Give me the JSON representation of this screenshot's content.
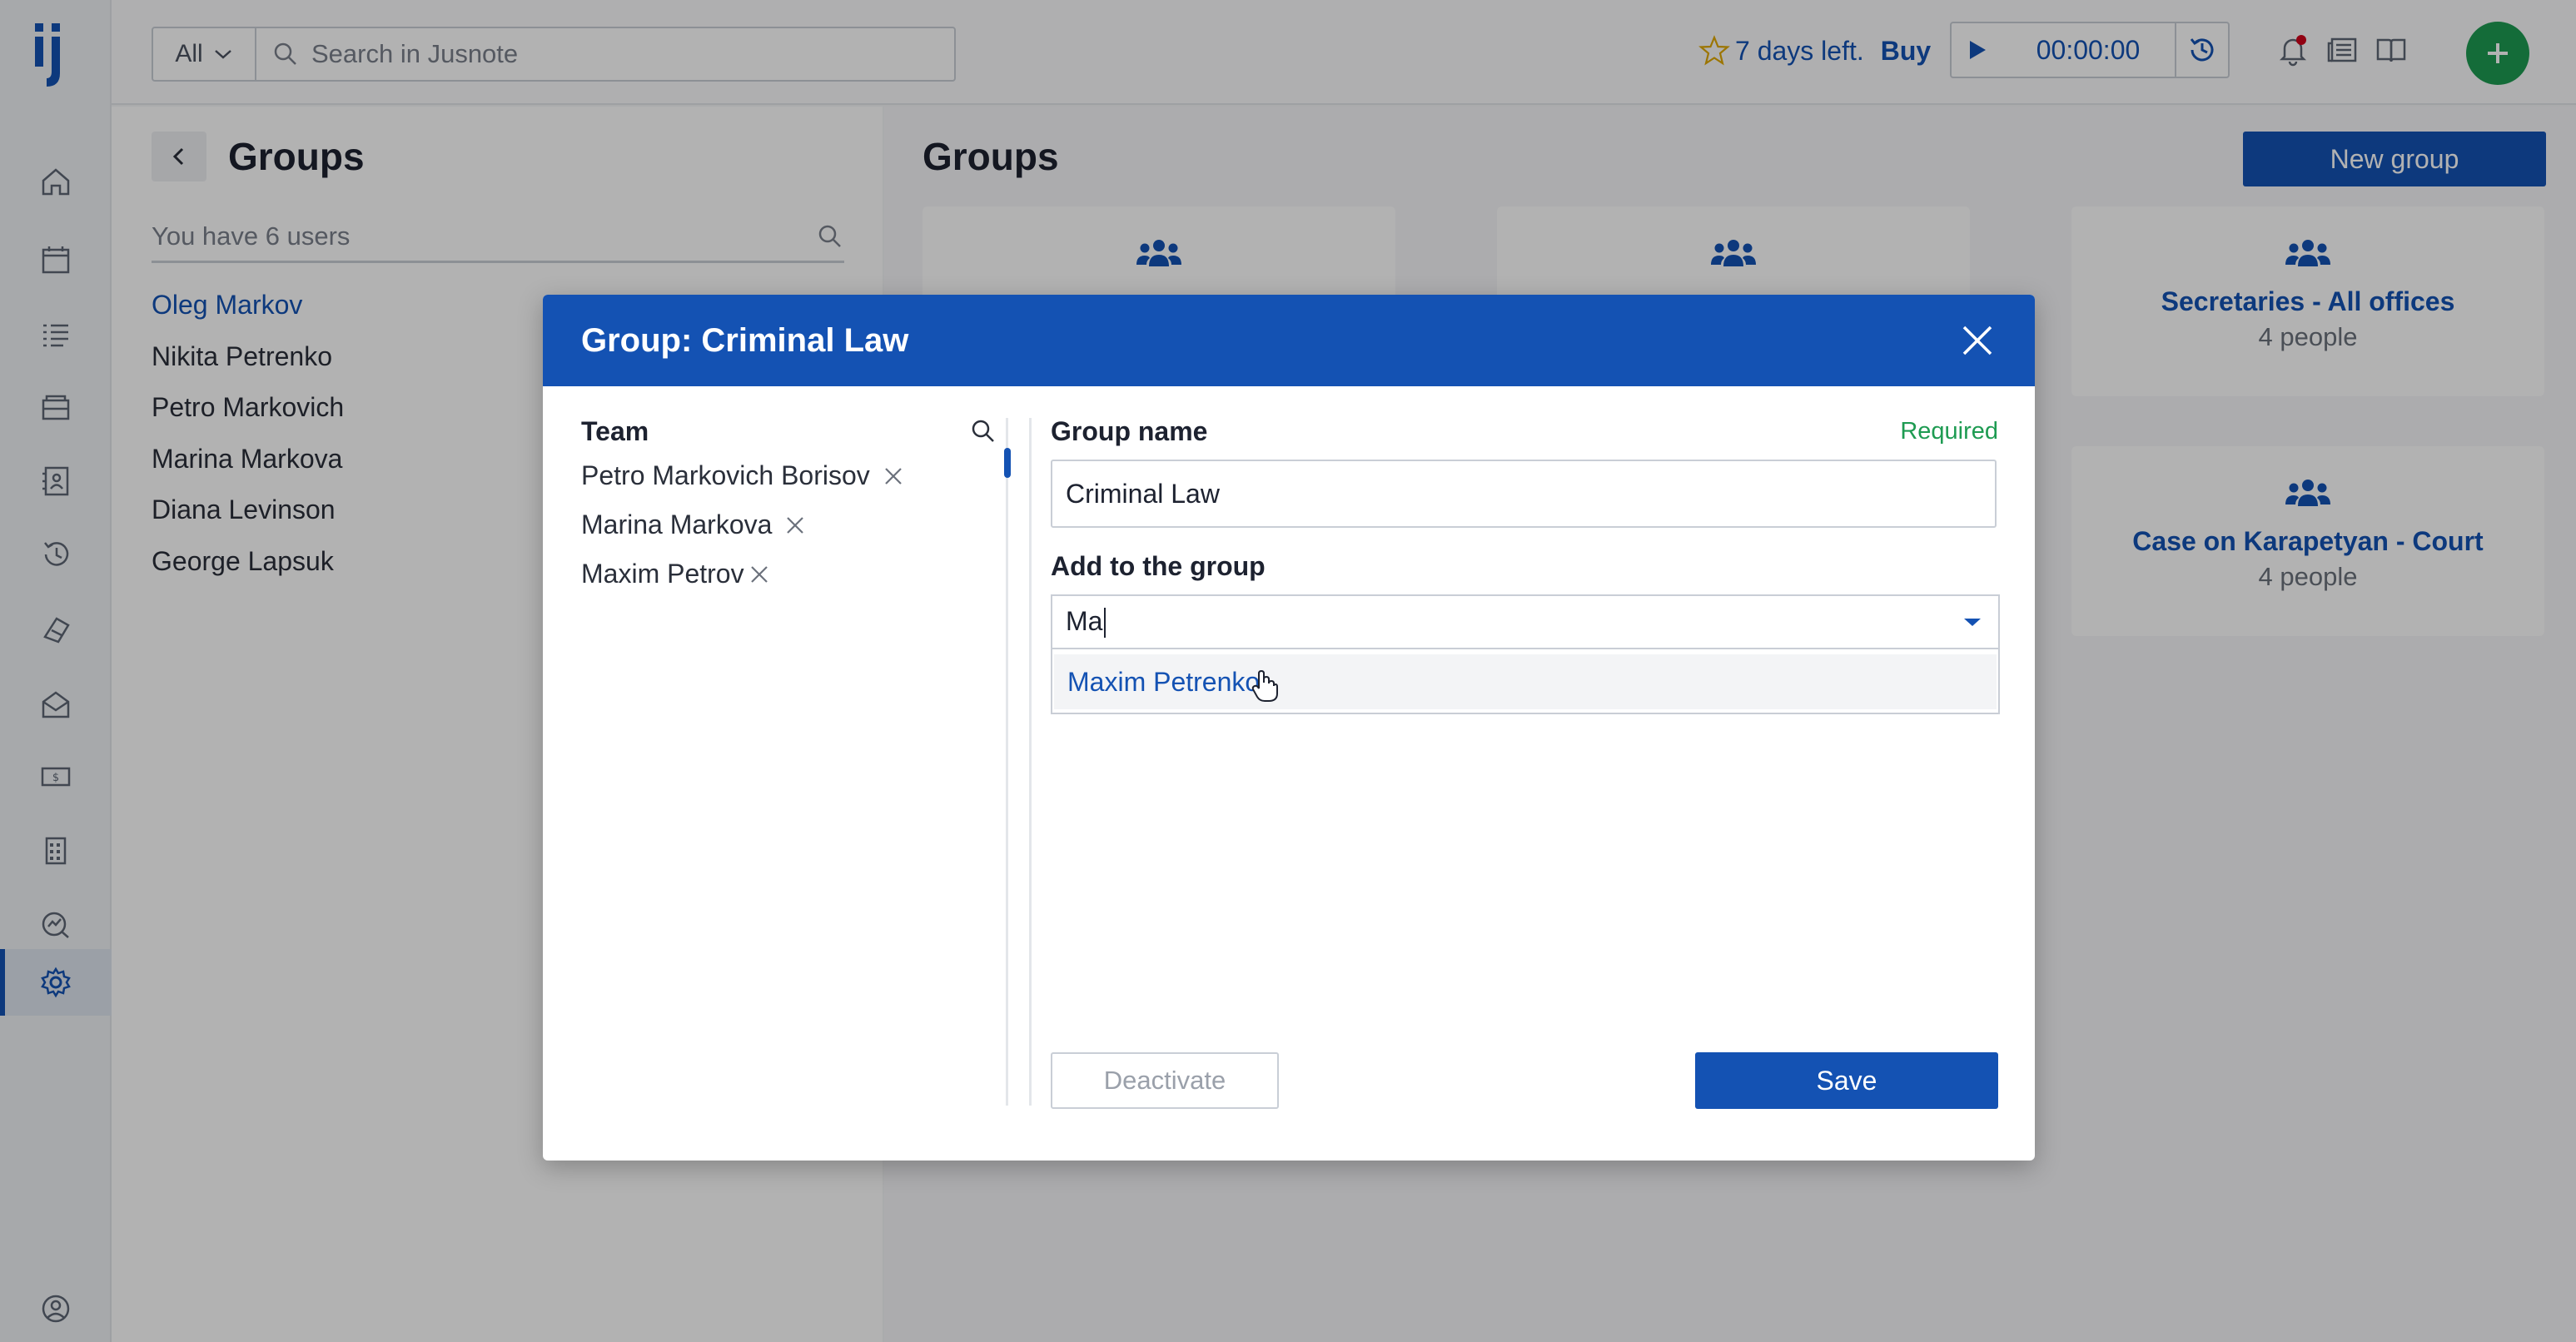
{
  "topbar": {
    "search_scope": "All",
    "search_placeholder": "Search in Jusnote",
    "trial_text": "7 days left.",
    "trial_buy": "Buy",
    "timer": "00:00:00"
  },
  "left_pane": {
    "title": "Groups",
    "users_search_placeholder": "You have 6 users",
    "users": [
      {
        "name": "Oleg Markov"
      },
      {
        "name": "Nikita Petrenko"
      },
      {
        "name": "Petro Markovich"
      },
      {
        "name": "Marina Markova"
      },
      {
        "name": "Diana Levinson"
      },
      {
        "name": "George Lapsuk"
      }
    ]
  },
  "right_pane": {
    "title": "Groups",
    "new_group_label": "New group",
    "groups": [
      {
        "name": "",
        "count": ""
      },
      {
        "name": "",
        "count": ""
      },
      {
        "name": "Secretaries - All offices",
        "count": "4 people"
      },
      {
        "name": "Case on Karapetyan - Court",
        "count": "4 people"
      }
    ]
  },
  "modal": {
    "title": "Group: Criminal Law",
    "team_label": "Team",
    "team_members": [
      {
        "name": "Petro Markovich Borisov"
      },
      {
        "name": "Marina Markova"
      },
      {
        "name": "Maxim Petrov"
      }
    ],
    "group_name_label": "Group name",
    "required_label": "Required",
    "group_name_value": "Criminal Law",
    "add_label": "Add to the group",
    "add_input_value": "Ma",
    "dropdown_option": "Maxim Petrenko",
    "deactivate_label": "Deactivate",
    "save_label": "Save"
  },
  "colors": {
    "brand_blue": "#1452b3",
    "success_green": "#1e9b52",
    "notification_red": "#d0021b"
  },
  "icons": [
    "logo-icon",
    "home-icon",
    "calendar-icon",
    "tasks-icon",
    "cases-icon",
    "contacts-icon",
    "history-icon",
    "billing-icon",
    "mail-icon",
    "invoice-icon",
    "documents-icon",
    "reports-icon",
    "settings-icon",
    "profile-icon",
    "search-icon",
    "star-icon",
    "play-icon",
    "clock-icon",
    "bell-icon",
    "news-icon",
    "book-icon",
    "plus-icon",
    "back-icon",
    "group-icon",
    "close-icon",
    "remove-icon",
    "dropdown-arrow-icon"
  ]
}
